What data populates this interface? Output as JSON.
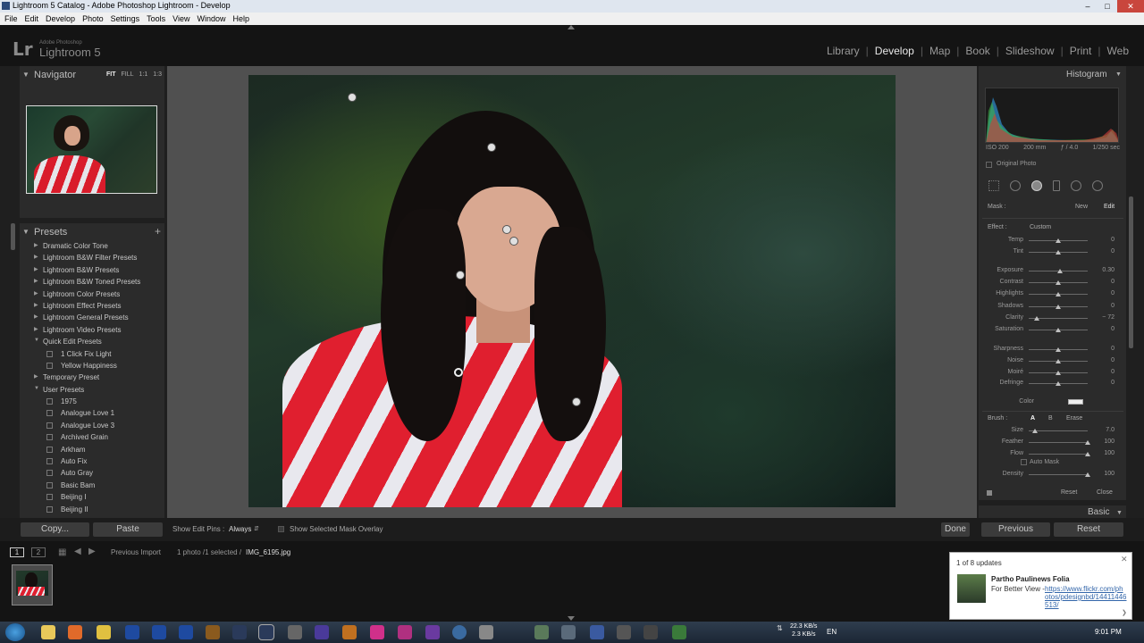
{
  "window": {
    "title": "Lightroom 5 Catalog - Adobe Photoshop Lightroom - Develop"
  },
  "menu": [
    "File",
    "Edit",
    "Develop",
    "Photo",
    "Settings",
    "Tools",
    "View",
    "Window",
    "Help"
  ],
  "brand": {
    "small": "Adobe Photoshop",
    "name": "Lightroom 5",
    "logo": "Lr"
  },
  "modules": [
    "Library",
    "Develop",
    "Map",
    "Book",
    "Slideshow",
    "Print",
    "Web"
  ],
  "navigator": {
    "title": "Navigator",
    "options": [
      "FIT",
      "FILL",
      "1:1",
      "1:3"
    ]
  },
  "presets": {
    "title": "Presets",
    "items": [
      {
        "label": "Dramatic Color Tone",
        "type": "folder",
        "open": false
      },
      {
        "label": "Lightroom B&W Filter Presets",
        "type": "folder",
        "open": false
      },
      {
        "label": "Lightroom B&W Presets",
        "type": "folder",
        "open": false
      },
      {
        "label": "Lightroom B&W Toned Presets",
        "type": "folder",
        "open": false
      },
      {
        "label": "Lightroom Color Presets",
        "type": "folder",
        "open": false
      },
      {
        "label": "Lightroom Effect Presets",
        "type": "folder",
        "open": false
      },
      {
        "label": "Lightroom General Presets",
        "type": "folder",
        "open": false
      },
      {
        "label": "Lightroom Video Presets",
        "type": "folder",
        "open": false
      },
      {
        "label": "Quick Edit Presets",
        "type": "folder",
        "open": true
      },
      {
        "label": "1 Click Fix Light",
        "type": "preset"
      },
      {
        "label": "Yellow Happiness",
        "type": "preset"
      },
      {
        "label": "Temporary Preset",
        "type": "folder",
        "open": false
      },
      {
        "label": "User Presets",
        "type": "folder",
        "open": true
      },
      {
        "label": "1975",
        "type": "preset"
      },
      {
        "label": "Analogue Love 1",
        "type": "preset"
      },
      {
        "label": "Analogue Love 3",
        "type": "preset"
      },
      {
        "label": "Archived Grain",
        "type": "preset"
      },
      {
        "label": "Arkham",
        "type": "preset"
      },
      {
        "label": "Auto Fix",
        "type": "preset"
      },
      {
        "label": "Auto Gray",
        "type": "preset"
      },
      {
        "label": "Basic Bam",
        "type": "preset"
      },
      {
        "label": "Beijing I",
        "type": "preset"
      },
      {
        "label": "Beijing II",
        "type": "preset"
      }
    ]
  },
  "left_buttons": {
    "copy": "Copy...",
    "paste": "Paste"
  },
  "toolbar": {
    "pins_label": "Show Edit Pins :",
    "pins_value": "Always",
    "mask_overlay_label": "Show Selected Mask Overlay",
    "done": "Done"
  },
  "histogram": {
    "title": "Histogram",
    "iso": "ISO 200",
    "focal": "200 mm",
    "aperture": "ƒ / 4.0",
    "shutter": "1/250 sec",
    "original_photo": "Original Photo"
  },
  "mask": {
    "label": "Mask :",
    "new": "New",
    "edit": "Edit"
  },
  "effect": {
    "label": "Effect :",
    "preset": "Custom",
    "sliders": [
      {
        "name": "Temp",
        "value": "0",
        "pos": 0.5
      },
      {
        "name": "Tint",
        "value": "0",
        "pos": 0.5
      },
      {
        "name": "Exposure",
        "value": "0.30",
        "pos": 0.53
      },
      {
        "name": "Contrast",
        "value": "0",
        "pos": 0.5
      },
      {
        "name": "Highlights",
        "value": "0",
        "pos": 0.5
      },
      {
        "name": "Shadows",
        "value": "0",
        "pos": 0.5
      },
      {
        "name": "Clarity",
        "value": "− 72",
        "pos": 0.14
      },
      {
        "name": "Saturation",
        "value": "0",
        "pos": 0.5
      },
      {
        "name": "Sharpness",
        "value": "0",
        "pos": 0.5
      },
      {
        "name": "Noise",
        "value": "0",
        "pos": 0.5
      },
      {
        "name": "Moiré",
        "value": "0",
        "pos": 0.5
      },
      {
        "name": "Defringe",
        "value": "0",
        "pos": 0.5
      }
    ],
    "color_label": "Color"
  },
  "brush": {
    "label": "Brush :",
    "a": "A",
    "b": "B",
    "erase": "Erase",
    "sliders": [
      {
        "name": "Size",
        "value": "7.0",
        "pos": 0.1
      },
      {
        "name": "Feather",
        "value": "100",
        "pos": 1.0
      },
      {
        "name": "Flow",
        "value": "100",
        "pos": 1.0
      }
    ],
    "auto_mask": "Auto Mask",
    "density": {
      "name": "Density",
      "value": "100",
      "pos": 1.0
    },
    "reset": "Reset",
    "close": "Close"
  },
  "basic_panel": "Basic",
  "right_buttons": {
    "previous": "Previous",
    "reset": "Reset"
  },
  "filmstrip": {
    "page1": "1",
    "page2": "2",
    "source": "Previous Import",
    "selection": "1 photo /1 selected /",
    "filename": "IMG_6195.jpg"
  },
  "notification": {
    "count": "1 of 8 updates",
    "name": "Partho Paulinews Folia",
    "text": "For Better View -",
    "link": "https://www.flickr.com/photos/pdesignbd/14411446513/"
  },
  "taskbar": {
    "lang": "EN",
    "up_speed": "22.3 KB/s",
    "down_speed": "2.3 KB/s",
    "time": "9:01 PM"
  },
  "colors": {
    "accent_red": "#e01f2f",
    "panel": "#2b2b2b",
    "active_text": "#e8e8e8"
  }
}
